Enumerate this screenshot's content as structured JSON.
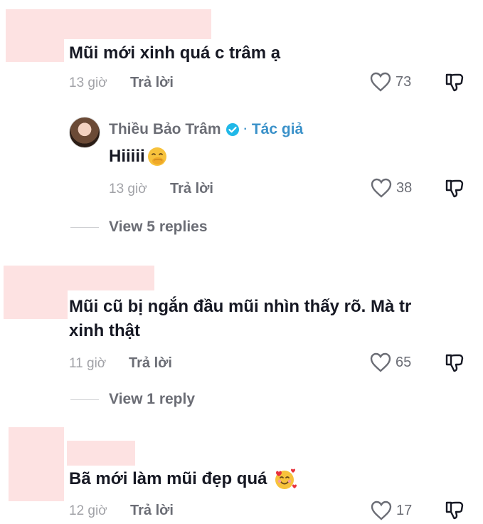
{
  "comments": [
    {
      "text": "Mũi mới xinh quá c trâm ạ",
      "time": "13 giờ",
      "reply_label": "Trả lời",
      "likes": "73"
    },
    {
      "text": "Mũi cũ bị ngắn đầu mũi nhìn thấy rõ. Mà tr xinh thật",
      "time": "11 giờ",
      "reply_label": "Trả lời",
      "likes": "65"
    },
    {
      "text": "Bã mới làm mũi đẹp quá",
      "time": "12 giờ",
      "reply_label": "Trả lời",
      "likes": "17"
    }
  ],
  "reply": {
    "author": "Thiều Bảo Trâm",
    "author_tag": "Tác giả",
    "text": "Hiiiii",
    "time": "13 giờ",
    "reply_label": "Trả lời",
    "likes": "38"
  },
  "view_replies": [
    "View 5 replies",
    "View 1 reply"
  ],
  "icons": {
    "like": "heart-outline-icon",
    "dislike": "thumbs-down-icon",
    "verified": "verified-badge-icon",
    "emoji_shush": "face-with-hand-over-mouth-emoji",
    "emoji_love": "smiling-face-with-hearts-emoji"
  },
  "colors": {
    "redaction": "#fde2e2",
    "verified": "#20b8e8",
    "author_tag": "#3a91c9"
  }
}
